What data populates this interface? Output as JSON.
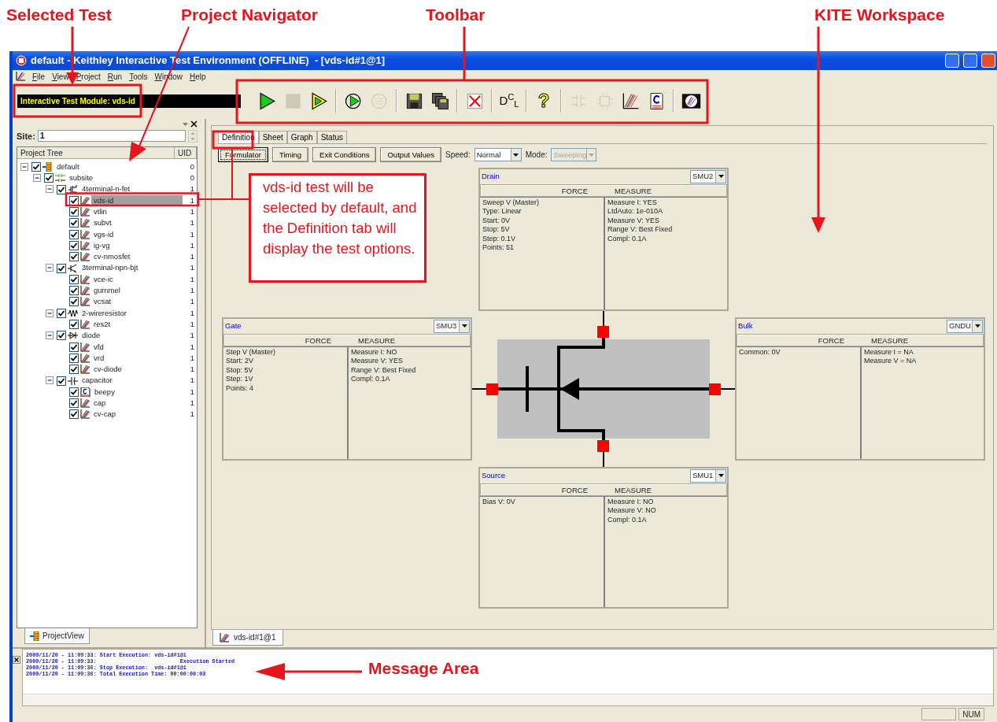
{
  "annotations": {
    "labels": [
      {
        "kind": "selected-test",
        "text": "Selected Test"
      },
      {
        "kind": "navigator",
        "text": "Project Navigator"
      },
      {
        "kind": "toolbar",
        "text": "Toolbar"
      },
      {
        "kind": "workspace",
        "text": "KITE Workspace"
      },
      {
        "kind": "message",
        "text": "Message Area"
      }
    ],
    "callout": "vds-id test will be selected by default, and the Definition tab will display the test options."
  },
  "window": {
    "title": "default - Keithley Interactive Test Environment (OFFLINE)  - [vds-id#1@1]"
  },
  "menu": [
    {
      "label": "File"
    },
    {
      "label": "View"
    },
    {
      "label": "Project"
    },
    {
      "label": "Run"
    },
    {
      "label": "Tools"
    },
    {
      "label": "Window"
    },
    {
      "label": "Help"
    }
  ],
  "selected_test": "Interactive Test Module: vds-id",
  "toolbar": [
    {
      "kind": "run",
      "disabled": false
    },
    {
      "kind": "stop",
      "disabled": true
    },
    {
      "kind": "append",
      "disabled": false
    },
    {
      "kind": "separator"
    },
    {
      "kind": "cycle",
      "disabled": false
    },
    {
      "kind": "subsite-cycle",
      "disabled": true
    },
    {
      "kind": "separator"
    },
    {
      "kind": "save",
      "disabled": false
    },
    {
      "kind": "save-all",
      "disabled": false
    },
    {
      "kind": "separator"
    },
    {
      "kind": "delete",
      "disabled": false
    },
    {
      "kind": "separator"
    },
    {
      "kind": "dcl",
      "text": "D$^{C}$$_{L}$",
      "disabled": false
    },
    {
      "kind": "separator"
    },
    {
      "kind": "help",
      "text": "?",
      "disabled": false
    },
    {
      "kind": "separator"
    },
    {
      "kind": "subsite-add",
      "disabled": true
    },
    {
      "kind": "device-add",
      "disabled": true
    },
    {
      "kind": "test-add",
      "disabled": false
    },
    {
      "kind": "ucm-add",
      "disabled": false
    },
    {
      "kind": "separator"
    },
    {
      "kind": "plot",
      "disabled": false
    }
  ],
  "navigator": {
    "site_label": "Site:",
    "site": "1",
    "columns": [
      "Project Tree",
      "UID"
    ],
    "tree": [
      {
        "kind": "project",
        "label": "default",
        "uid": "0",
        "checked": true,
        "expanded": true,
        "selected": false,
        "children": [
          {
            "kind": "subsite",
            "label": "subsite",
            "uid": "0",
            "checked": true,
            "expanded": true,
            "selected": false,
            "children": [
              {
                "kind": "fet",
                "label": "4terminal-n-fet",
                "uid": "1",
                "checked": true,
                "expanded": true,
                "selected": false,
                "children": [
                  {
                    "kind": "itm",
                    "label": "vds-id",
                    "uid": "1",
                    "checked": true,
                    "selected": true
                  },
                  {
                    "kind": "itm",
                    "label": "vtlin",
                    "uid": "1",
                    "checked": true,
                    "selected": false
                  },
                  {
                    "kind": "itm",
                    "label": "subvt",
                    "uid": "1",
                    "checked": true,
                    "selected": false
                  },
                  {
                    "kind": "itm",
                    "label": "vgs-id",
                    "uid": "1",
                    "checked": true,
                    "selected": false
                  },
                  {
                    "kind": "itm",
                    "label": "ig-vg",
                    "uid": "1",
                    "checked": true,
                    "selected": false
                  },
                  {
                    "kind": "itm",
                    "label": "cv-nmosfet",
                    "uid": "1",
                    "checked": true,
                    "selected": false
                  }
                ]
              },
              {
                "kind": "bjt",
                "label": "3terminal-npn-bjt",
                "uid": "1",
                "checked": true,
                "expanded": true,
                "selected": false,
                "children": [
                  {
                    "kind": "itm",
                    "label": "vce-ic",
                    "uid": "1",
                    "checked": true,
                    "selected": false
                  },
                  {
                    "kind": "itm",
                    "label": "gummel",
                    "uid": "1",
                    "checked": true,
                    "selected": false
                  },
                  {
                    "kind": "itm",
                    "label": "vcsat",
                    "uid": "1",
                    "checked": true,
                    "selected": false
                  }
                ]
              },
              {
                "kind": "resistor",
                "label": "2-wireresistor",
                "uid": "1",
                "checked": true,
                "expanded": true,
                "selected": false,
                "children": [
                  {
                    "kind": "itm",
                    "label": "res2t",
                    "uid": "1",
                    "checked": true,
                    "selected": false
                  }
                ]
              },
              {
                "kind": "diode",
                "label": "diode",
                "uid": "1",
                "checked": true,
                "expanded": true,
                "selected": false,
                "children": [
                  {
                    "kind": "itm",
                    "label": "vfd",
                    "uid": "1",
                    "checked": true,
                    "selected": false
                  },
                  {
                    "kind": "itm",
                    "label": "vrd",
                    "uid": "1",
                    "checked": true,
                    "selected": false
                  },
                  {
                    "kind": "itm",
                    "label": "cv-diode",
                    "uid": "1",
                    "checked": true,
                    "selected": false
                  }
                ]
              },
              {
                "kind": "capacitor",
                "label": "capacitor",
                "uid": "1",
                "checked": true,
                "expanded": true,
                "selected": false,
                "children": [
                  {
                    "kind": "ucm",
                    "label": "beepy",
                    "uid": "1",
                    "checked": true,
                    "selected": false
                  },
                  {
                    "kind": "itm",
                    "label": "cap",
                    "uid": "1",
                    "checked": true,
                    "selected": false
                  },
                  {
                    "kind": "itm",
                    "label": "cv-cap",
                    "uid": "1",
                    "checked": true,
                    "selected": false
                  }
                ]
              }
            ]
          }
        ]
      }
    ],
    "tab": "ProjectView"
  },
  "workspace": {
    "tabs": [
      {
        "label": "Definition",
        "selected": true
      },
      {
        "label": "Sheet",
        "selected": false
      },
      {
        "label": "Graph",
        "selected": false
      },
      {
        "label": "Status",
        "selected": false
      }
    ],
    "buttons": [
      {
        "label": "Formulator",
        "focused": true
      },
      {
        "label": "Timing",
        "focused": false
      },
      {
        "label": "Exit Conditions",
        "focused": false
      },
      {
        "label": "Output Values",
        "focused": false
      }
    ],
    "speed": {
      "label": "Speed:",
      "value": "Normal",
      "disabled": false
    },
    "mode": {
      "label": "Mode:",
      "value": "Sweeping",
      "disabled": true
    },
    "terminals": [
      {
        "name": "Drain",
        "instrument": "SMU2",
        "force_label": "FORCE",
        "measure_label": "MEASURE",
        "force": [
          "Sweep V (Master)",
          "Type: Linear",
          "Start: 0V",
          "Stop: 5V",
          "Step: 0.1V",
          "Points: 51"
        ],
        "measure": [
          "Measure I: YES",
          "LtdAuto: 1e-010A",
          "Measure V: YES",
          "Range V: Best Fixed",
          "Compl: 0.1A"
        ]
      },
      {
        "name": "Gate",
        "instrument": "SMU3",
        "force_label": "FORCE",
        "measure_label": "MEASURE",
        "force": [
          "Step V (Master)",
          "Start: 2V",
          "Stop: 5V",
          "Step: 1V",
          "Points: 4"
        ],
        "measure": [
          "Measure I: NO",
          "Measure V: YES",
          "Range V: Best Fixed",
          "Compl: 0.1A"
        ]
      },
      {
        "name": "Bulk",
        "instrument": "GNDU",
        "force_label": "FORCE",
        "measure_label": "MEASURE",
        "force": [
          "Common: 0V"
        ],
        "measure": [
          "Measure I = NA",
          "Measure V = NA"
        ]
      },
      {
        "name": "Source",
        "instrument": "SMU1",
        "force_label": "FORCE",
        "measure_label": "MEASURE",
        "force": [
          "Bias V: 0V"
        ],
        "measure": [
          "Measure I: NO",
          "Measure V: NO",
          "Compl: 0.1A"
        ]
      }
    ],
    "doc_tab": "vds-id#1@1"
  },
  "messages": [
    "2009/11/20 - 11:09:33: Start Execution: vds-id#1@1",
    "2009/11/20 - 11:09:33:                          Execution Started",
    "2009/11/20 - 11:09:36: Stop Execution:  vds-id#1@1",
    "2009/11/20 - 11:09:36: Total Execution Time: 00:00:00:03"
  ],
  "status_bar": {
    "indicator": "NUM"
  }
}
